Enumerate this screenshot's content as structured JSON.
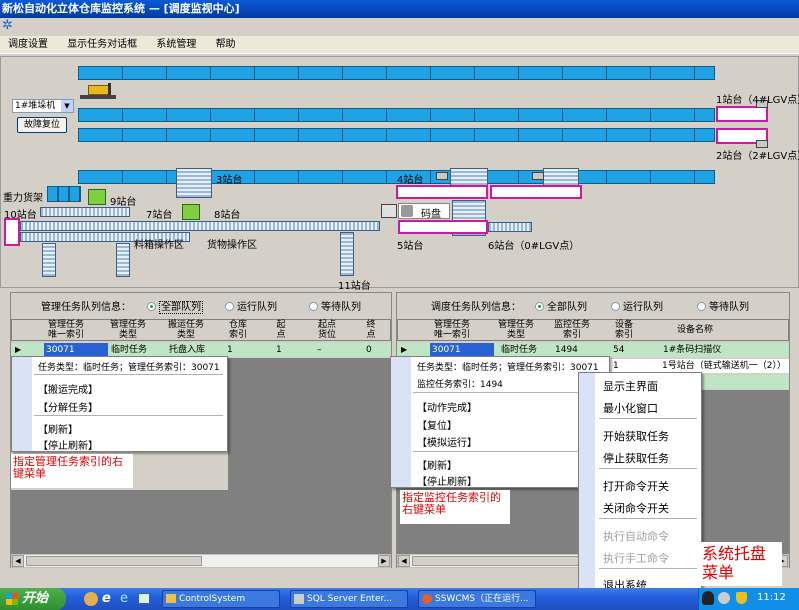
{
  "window": {
    "title": "新松自动化立体仓库监控系统 — [调度监视中心]"
  },
  "menu": {
    "items": [
      "调度设置",
      "显示任务对话框",
      "系统管理",
      "帮助"
    ]
  },
  "stacker": {
    "selected": "1#堆垛机",
    "reset_button": "故障复位"
  },
  "stations": {
    "s1": "1站台（4#LGV点）",
    "s2": "2站台（2#LGV点）",
    "s3": "3站台",
    "s4": "4站台",
    "s5": "5站台",
    "s6": "6站台（0#LGV点）",
    "s7": "7站台",
    "s8": "8站台",
    "s9": "9站台",
    "s10": "10站台",
    "s11": "11站台",
    "gravity_rack": "重力货架",
    "code_area": "码盘区",
    "material_area": "料箱操作区",
    "goods_area": "货物操作区"
  },
  "left_panel": {
    "title": "管理任务队列信息：",
    "radios": [
      "全部队列",
      "运行队列",
      "等待队列"
    ],
    "headers": [
      "管理任务唯一索引",
      "管理任务类型",
      "搬运任务类型",
      "仓库索引",
      "起点",
      "起点货位",
      "终点"
    ],
    "row": [
      "30071",
      "临时任务",
      "托盘入库",
      "1",
      "1",
      "–",
      "0"
    ]
  },
  "right_panel": {
    "title": "调度任务队列信息：",
    "radios": [
      "全部队列",
      "运行队列",
      "等待队列"
    ],
    "headers": [
      "管理任务唯一索引",
      "管理任务类型",
      "监控任务索引",
      "设备索引",
      "设备名称"
    ],
    "row1": [
      "30071",
      "临时任务",
      "1494",
      "54",
      "1#条码扫描仪"
    ],
    "row2": [
      "1",
      "1号站台（链式输送机一（2））"
    ]
  },
  "left_menu": {
    "info": "任务类型：临时任务；管理任务索引：30071",
    "items": [
      "【搬运完成】",
      "【分解任务】",
      "【刷新】",
      "【停止刷新】"
    ],
    "caption": "指定管理任务索引的右键菜单"
  },
  "mid_menu": {
    "info1": "任务类型：临时任务；管理任务索引：30071",
    "info2": "监控任务索引：1494",
    "items": [
      "【动作完成】",
      "【复位】",
      "【模拟运行】",
      "【刷新】",
      "【停止刷新】"
    ],
    "caption": "指定监控任务索引的右键菜单"
  },
  "tray_menu": {
    "items": [
      "显示主界面",
      "最小化窗口",
      "开始获取任务",
      "停止获取任务",
      "打开命令开关",
      "关闭命令开关",
      "执行自动命令",
      "执行手工命令",
      "退出系统"
    ],
    "caption": "系统托盘菜单"
  },
  "taskbar": {
    "start": "开始",
    "tasks": [
      "ControlSystem",
      "SQL Server Enter...",
      "SSWCMS（正在运行..."
    ],
    "clock": "11:12"
  },
  "colors": {
    "conveyor": "#1fa3e4",
    "highlight": "#d0179e",
    "row_selected": "#bfe6c4",
    "caption_red": "#e00000"
  }
}
